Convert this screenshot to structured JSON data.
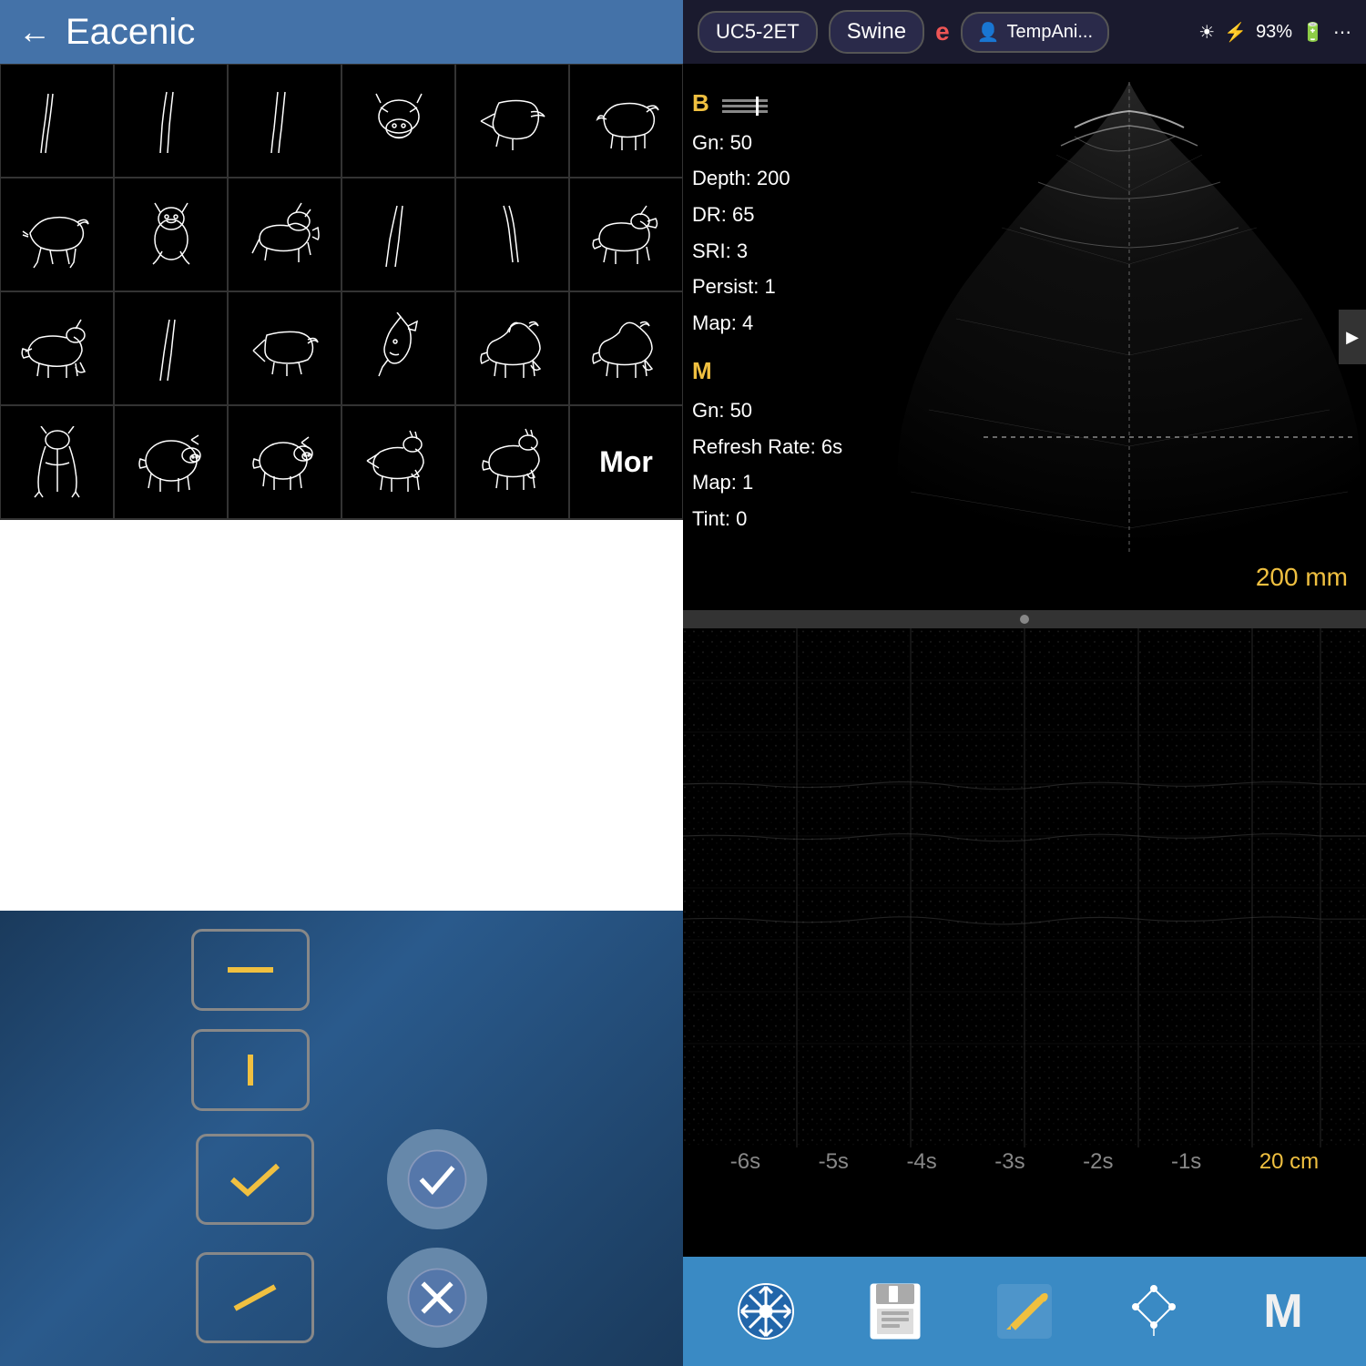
{
  "left_panel": {
    "header": {
      "back_label": "←",
      "title": "Eacenic"
    },
    "animal_grid": {
      "rows": [
        [
          "leg-anatomy-1",
          "leg-anatomy-2",
          "leg-anatomy-3",
          "cow-head",
          "cow-arrow",
          "cow-side"
        ],
        [
          "cow-walking",
          "cat-sitting",
          "cat-walking",
          "leg-anatomy-4",
          "leg-anatomy-5",
          "dog-standing"
        ],
        [
          "dog-silhouette",
          "leg-anatomy-6",
          "animal-lying",
          "horse-head",
          "horse-full",
          "horse-standing"
        ],
        [
          "cat-hanging",
          "pig-body",
          "pig-side",
          "goat-walking",
          "goat-standing",
          "more"
        ]
      ],
      "more_label": "Mor"
    },
    "controls": {
      "horizontal_bar_label": "—",
      "vertical_bar_label": "|",
      "check_label": "✓",
      "cancel_label": "✗",
      "confirm_check_label": "✓",
      "confirm_cancel_label": "✗"
    }
  },
  "right_panel": {
    "top_bar": {
      "probe_label": "UC5-2ET",
      "swine_label": "Swine",
      "animal_indicator": "e",
      "user_label": "TempAni...",
      "sun_icon": "☀",
      "usb_icon": "⚡",
      "battery_label": "93%",
      "battery_icon": "🔋",
      "more_icon": "⋯"
    },
    "params": {
      "b_label": "B",
      "b_gn": "Gn: 50",
      "depth": "Depth: 200",
      "dr": "DR: 65",
      "sri": "SRI: 3",
      "persist": "Persist: 1",
      "map": "Map: 4",
      "m_label": "M",
      "m_gn": "Gn: 50",
      "refresh_rate": "Refresh Rate: 6s",
      "m_map": "Map: 1",
      "tint": "Tint: 0"
    },
    "depth_label": "200 mm",
    "time_labels": [
      "-6s",
      "-5s",
      "-4s",
      "-3s",
      "-2s",
      "-1s"
    ],
    "cm_label": "20 cm",
    "bottom_nav": {
      "freeze_label": "❄",
      "save_label": "💾",
      "edit_label": "✏",
      "measure_label": "✦",
      "m_mode_label": "M"
    }
  }
}
